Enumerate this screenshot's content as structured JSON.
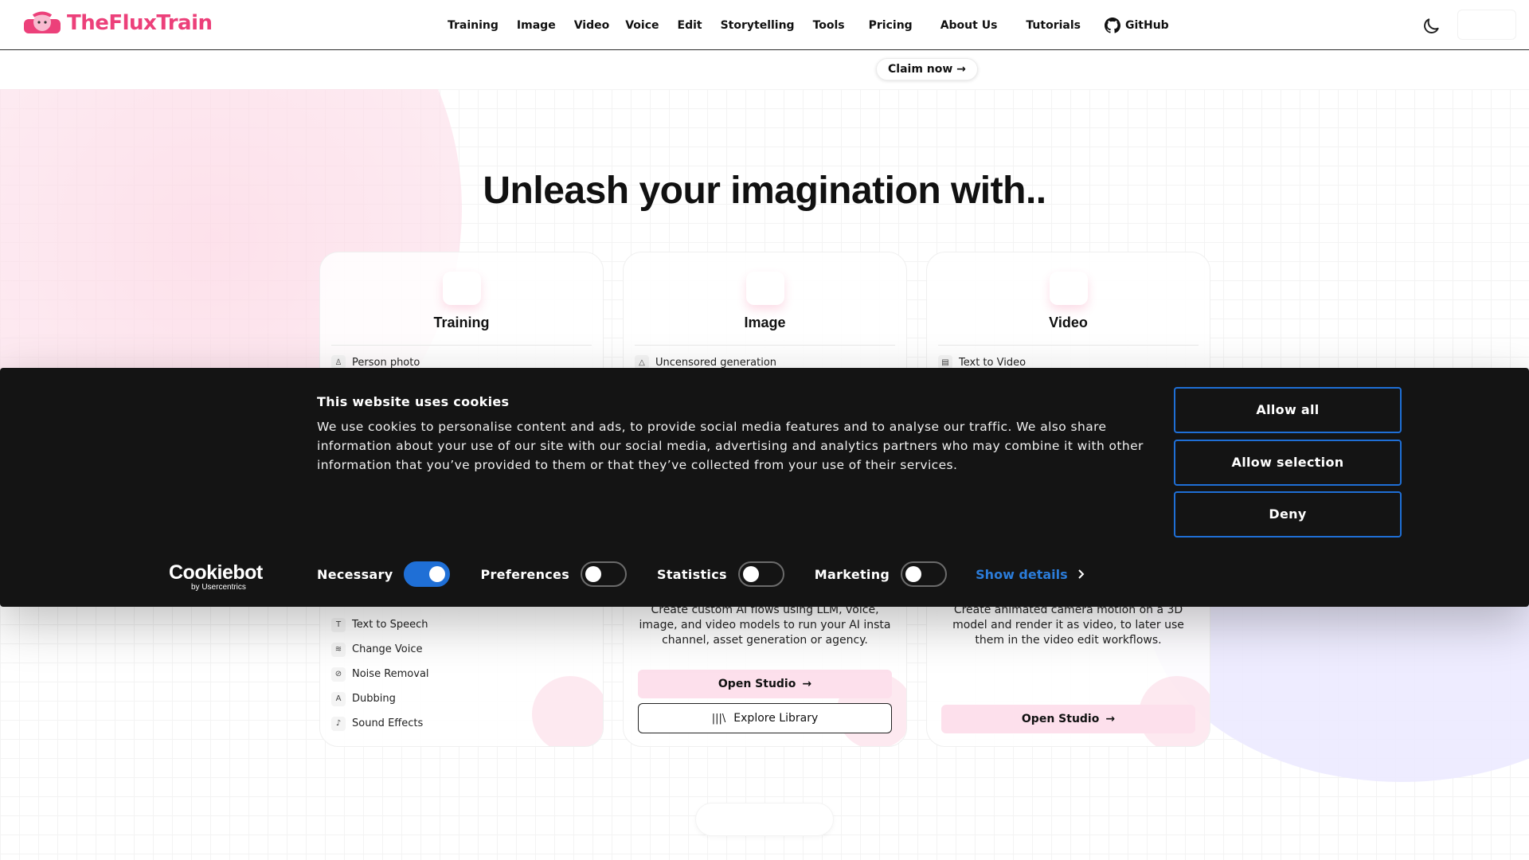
{
  "header": {
    "brand": "TheFluxTrain",
    "nav": [
      {
        "id": "training",
        "label": "Training"
      },
      {
        "id": "image",
        "label": "Image"
      },
      {
        "id": "video",
        "label": "Video"
      },
      {
        "id": "voice",
        "label": "Voice"
      },
      {
        "id": "edit",
        "label": "Edit"
      },
      {
        "id": "storytelling",
        "label": "Storytelling"
      },
      {
        "id": "tools",
        "label": "Tools"
      },
      {
        "id": "pricing",
        "label": "Pricing"
      },
      {
        "id": "about",
        "label": "About Us"
      },
      {
        "id": "tutorials",
        "label": "Tutorials"
      }
    ],
    "github_label": "GitHub"
  },
  "promo": {
    "claim_label": "Claim now →"
  },
  "hero": {
    "title": "Unleash your imagination with.."
  },
  "cards": [
    {
      "title": "Training",
      "first_item": "Person photo"
    },
    {
      "title": "Image",
      "first_item": "Uncensored generation"
    },
    {
      "title": "Video",
      "first_item": "Text to Video"
    }
  ],
  "voice_list": [
    "Text to Speech",
    "Change Voice",
    "Noise Removal",
    "Dubbing",
    "Sound Effects"
  ],
  "studio_card": {
    "description": "Create custom AI flows using LLM, voice, image, and video models to run your AI insta channel, asset generation or agency.",
    "open_label": "Open Studio",
    "library_label": "Explore Library"
  },
  "motion_card": {
    "description": "Create animated camera motion on a 3D model and render it as video, to later use them in the video edit workflows.",
    "open_label": "Open Studio"
  },
  "cookie": {
    "title": "This website uses cookies",
    "text": "We use cookies to personalise content and ads, to provide social media features and to analyse our traffic. We also share information about your use of our site with our social media, advertising and analytics partners who may combine it with other information that you’ve provided to them or that they’ve collected from your use of their services.",
    "allow_all": "Allow all",
    "allow_selection": "Allow selection",
    "deny": "Deny",
    "logo_word": "Cookiebot",
    "logo_sub": "by Usercentrics",
    "toggles": [
      {
        "label": "Necessary",
        "on": true
      },
      {
        "label": "Preferences",
        "on": false
      },
      {
        "label": "Statistics",
        "on": false
      },
      {
        "label": "Marketing",
        "on": false
      }
    ],
    "show_details": "Show details"
  },
  "colors": {
    "brand": "#ec407a",
    "cookie_accent": "#1f6fd6",
    "cookie_bg": "#141414"
  }
}
